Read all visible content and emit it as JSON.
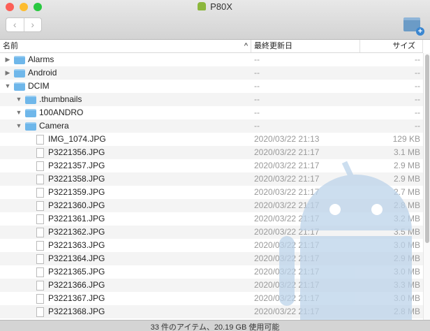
{
  "window": {
    "title": "P80X",
    "back": "‹",
    "forward": "›"
  },
  "columns": {
    "name": "名前",
    "date": "最終更新日",
    "size": "サイズ",
    "sort": "^"
  },
  "rows": [
    {
      "type": "folder",
      "level": 0,
      "expanded": false,
      "name": "Alarms",
      "date": "--",
      "size": "--"
    },
    {
      "type": "folder",
      "level": 0,
      "expanded": false,
      "name": "Android",
      "date": "--",
      "size": "--"
    },
    {
      "type": "folder",
      "level": 0,
      "expanded": true,
      "name": "DCIM",
      "date": "--",
      "size": "--"
    },
    {
      "type": "folder",
      "level": 1,
      "expanded": true,
      "name": ".thumbnails",
      "date": "--",
      "size": "--"
    },
    {
      "type": "folder",
      "level": 1,
      "expanded": true,
      "name": "100ANDRO",
      "date": "--",
      "size": "--"
    },
    {
      "type": "folder",
      "level": 1,
      "expanded": true,
      "name": "Camera",
      "date": "--",
      "size": "--"
    },
    {
      "type": "file",
      "level": 2,
      "name": "IMG_1074.JPG",
      "date": "2020/03/22 21:13",
      "size": "129 KB"
    },
    {
      "type": "file",
      "level": 2,
      "name": "P3221356.JPG",
      "date": "2020/03/22 21:17",
      "size": "3.1 MB"
    },
    {
      "type": "file",
      "level": 2,
      "name": "P3221357.JPG",
      "date": "2020/03/22 21:17",
      "size": "2.9 MB"
    },
    {
      "type": "file",
      "level": 2,
      "name": "P3221358.JPG",
      "date": "2020/03/22 21:17",
      "size": "2.9 MB"
    },
    {
      "type": "file",
      "level": 2,
      "name": "P3221359.JPG",
      "date": "2020/03/22 21:17",
      "size": "2.7 MB"
    },
    {
      "type": "file",
      "level": 2,
      "name": "P3221360.JPG",
      "date": "2020/03/22 21:17",
      "size": "2.8 MB"
    },
    {
      "type": "file",
      "level": 2,
      "name": "P3221361.JPG",
      "date": "2020/03/22 21:17",
      "size": "3.2 MB"
    },
    {
      "type": "file",
      "level": 2,
      "name": "P3221362.JPG",
      "date": "2020/03/22 21:17",
      "size": "3.5 MB"
    },
    {
      "type": "file",
      "level": 2,
      "name": "P3221363.JPG",
      "date": "2020/03/22 21:17",
      "size": "3.0 MB"
    },
    {
      "type": "file",
      "level": 2,
      "name": "P3221364.JPG",
      "date": "2020/03/22 21:17",
      "size": "2.9 MB"
    },
    {
      "type": "file",
      "level": 2,
      "name": "P3221365.JPG",
      "date": "2020/03/22 21:17",
      "size": "3.0 MB"
    },
    {
      "type": "file",
      "level": 2,
      "name": "P3221366.JPG",
      "date": "2020/03/22 21:17",
      "size": "3.3 MB"
    },
    {
      "type": "file",
      "level": 2,
      "name": "P3221367.JPG",
      "date": "2020/03/22 21:17",
      "size": "3.0 MB"
    },
    {
      "type": "file",
      "level": 2,
      "name": "P3221368.JPG",
      "date": "2020/03/22 21:17",
      "size": "2.8 MB"
    }
  ],
  "status": "33 件のアイテム、20.19 GB 使用可能"
}
